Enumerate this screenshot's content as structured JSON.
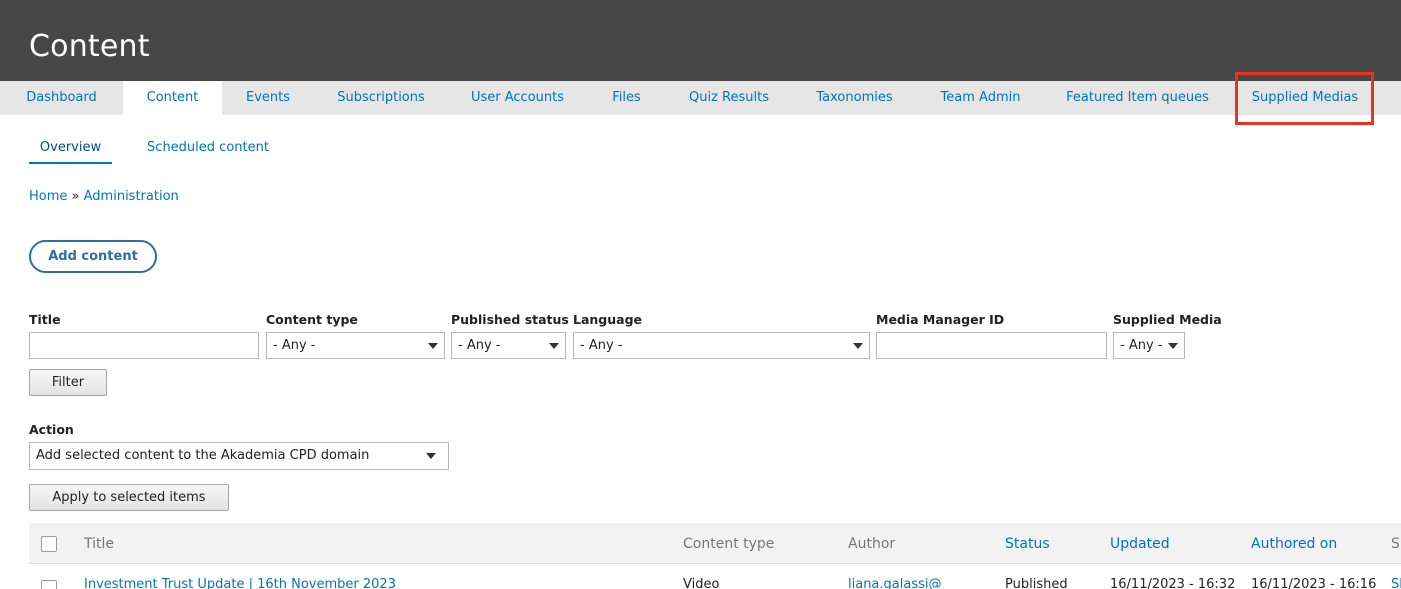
{
  "header": {
    "title": "Content"
  },
  "primary_tabs": [
    {
      "label": "Dashboard",
      "active": false
    },
    {
      "label": "Content",
      "active": true
    },
    {
      "label": "Events",
      "active": false
    },
    {
      "label": "Subscriptions",
      "active": false
    },
    {
      "label": "User Accounts",
      "active": false
    },
    {
      "label": "Files",
      "active": false
    },
    {
      "label": "Quiz Results",
      "active": false
    },
    {
      "label": "Taxonomies",
      "active": false
    },
    {
      "label": "Team Admin",
      "active": false
    },
    {
      "label": "Featured Item queues",
      "active": false
    },
    {
      "label": "Supplied Medias",
      "active": false,
      "highlighted": true
    }
  ],
  "secondary_tabs": [
    {
      "label": "Overview",
      "active": true
    },
    {
      "label": "Scheduled content",
      "active": false
    }
  ],
  "breadcrumb": {
    "home": "Home",
    "separator": "»",
    "admin": "Administration"
  },
  "add_content_label": "Add content",
  "filters": {
    "title_label": "Title",
    "title_value": "",
    "content_type_label": "Content type",
    "content_type_value": "- Any -",
    "published_status_label": "Published status",
    "published_status_value": "- Any -",
    "language_label": "Language",
    "language_value": "- Any -",
    "media_manager_label": "Media Manager ID",
    "media_manager_value": "",
    "supplied_media_label": "Supplied Media",
    "supplied_media_value": "- Any -",
    "filter_button": "Filter"
  },
  "action": {
    "label": "Action",
    "selected": "Add selected content to the Akademia CPD domain",
    "apply_button": "Apply to selected items"
  },
  "table": {
    "headers": {
      "title": "Title",
      "content_type": "Content type",
      "author": "Author",
      "status": "Status",
      "updated": "Updated",
      "authored_on": "Authored on",
      "last": "S"
    },
    "rows": [
      {
        "title": "Investment Trust Update | 16th November 2023",
        "content_type": "Video",
        "author": "liana.galassi@",
        "status": "Published",
        "updated": "16/11/2023 - 16:32",
        "authored_on": "16/11/2023 - 16:16",
        "last": "Sl"
      }
    ]
  },
  "colors": {
    "header_bg": "#474747",
    "link": "#0074bd",
    "highlight": "#e8331e",
    "tab_bar": "#e6e6e6"
  }
}
